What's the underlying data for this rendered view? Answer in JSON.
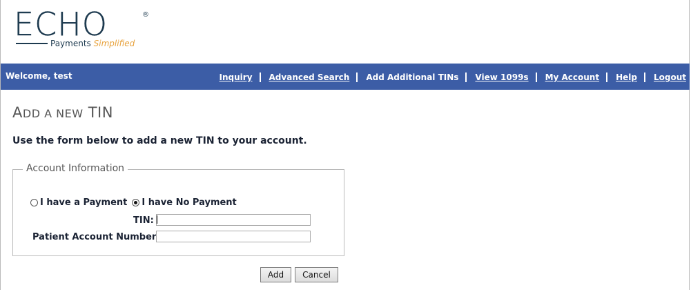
{
  "logo": {
    "wordmark": "ECHO",
    "registered": "®",
    "tagline": "Payments",
    "tagline_accent": "Simplified"
  },
  "navbar": {
    "welcome": "Welcome, test",
    "links": [
      {
        "label": "Inquiry",
        "current": false
      },
      {
        "label": "Advanced Search",
        "current": false
      },
      {
        "label": "Add Additional TINs",
        "current": true
      },
      {
        "label": "View 1099s",
        "current": false
      },
      {
        "label": "My Account",
        "current": false
      },
      {
        "label": "Help",
        "current": false
      },
      {
        "label": "Logout",
        "current": false
      }
    ],
    "color": "#3c5da6"
  },
  "page": {
    "title_first": "A",
    "title_mid": "DD A NEW",
    "title_last": "TIN",
    "intro": "Use the form below to add a new TIN to your account."
  },
  "form": {
    "legend": "Account Information",
    "radio_payment": {
      "label": "I have a Payment",
      "checked": false
    },
    "radio_no_payment": {
      "label": "I have No Payment",
      "checked": true
    },
    "tin_label": "TIN:",
    "tin_value": "",
    "patient_account_label": "Patient Account Number:",
    "patient_account_value": ""
  },
  "buttons": {
    "add": "Add",
    "cancel": "Cancel"
  }
}
